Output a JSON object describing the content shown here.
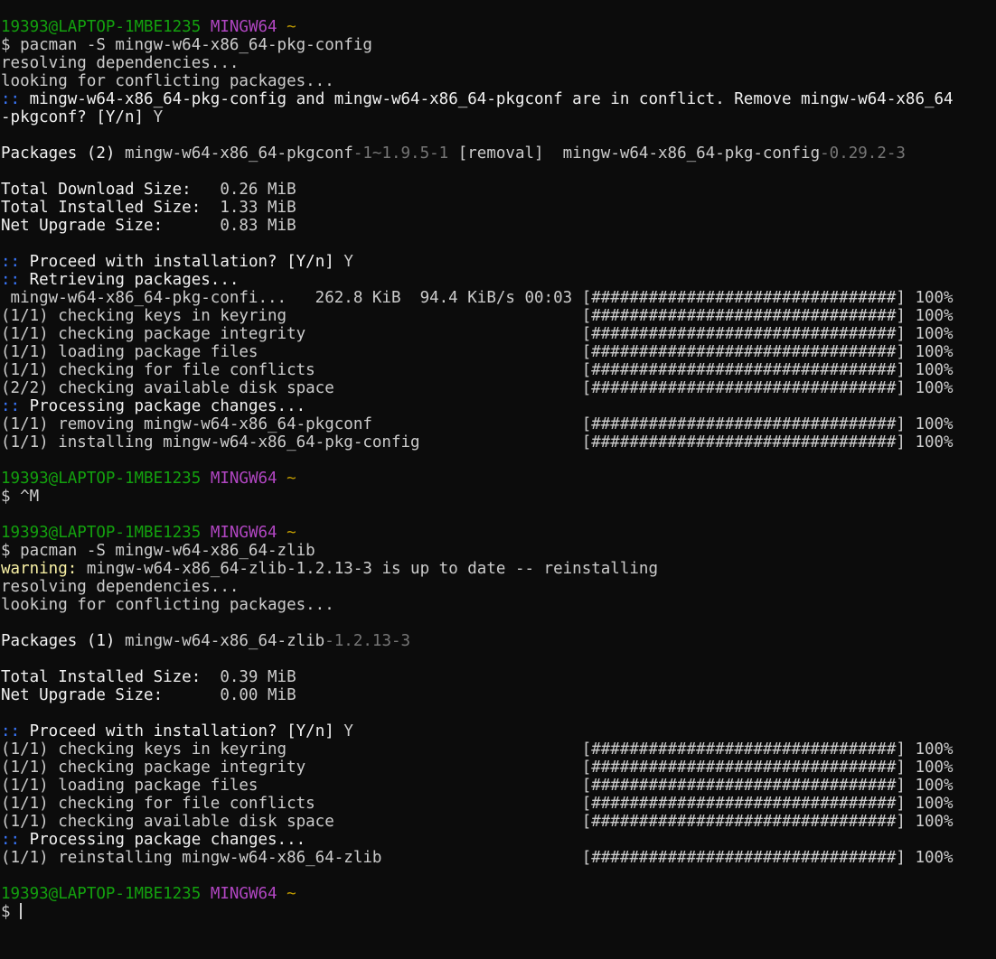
{
  "terminal": {
    "lines": [
      [
        {
          "text": "19393@LAPTOP-1MBE1235",
          "c": "green"
        },
        {
          "text": " ",
          "c": "default"
        },
        {
          "text": "MINGW64",
          "c": "magenta"
        },
        {
          "text": " ",
          "c": "default"
        },
        {
          "text": "~",
          "c": "yellow"
        }
      ],
      [
        {
          "text": "$ pacman -S mingw-w64-x86_64-pkg-config",
          "c": "default"
        }
      ],
      [
        {
          "text": "resolving dependencies...",
          "c": "default"
        }
      ],
      [
        {
          "text": "looking for conflicting packages...",
          "c": "default"
        }
      ],
      [
        {
          "text": "::",
          "c": "blue"
        },
        {
          "text": " mingw-w64-x86_64-pkg-config and mingw-w64-x86_64-pkgconf are in conflict. Remove mingw-w64-x86_64",
          "c": "white"
        }
      ],
      [
        {
          "text": "-pkgconf? [Y/n] ",
          "c": "white"
        },
        {
          "text": "Y",
          "c": "default"
        }
      ],
      [],
      [
        {
          "text": "Packages (2) ",
          "c": "white"
        },
        {
          "text": "mingw-w64-x86_64-pkgconf",
          "c": "default"
        },
        {
          "text": "-1~1.9.5-1",
          "c": "gray"
        },
        {
          "text": " [removal]  ",
          "c": "default"
        },
        {
          "text": "mingw-w64-x86_64-pkg-config",
          "c": "default"
        },
        {
          "text": "-0.29.2-3",
          "c": "gray"
        }
      ],
      [],
      [
        {
          "text": "Total Download Size:   ",
          "c": "white"
        },
        {
          "text": "0.26 MiB",
          "c": "default"
        }
      ],
      [
        {
          "text": "Total Installed Size:  ",
          "c": "white"
        },
        {
          "text": "1.33 MiB",
          "c": "default"
        }
      ],
      [
        {
          "text": "Net Upgrade Size:      ",
          "c": "white"
        },
        {
          "text": "0.83 MiB",
          "c": "default"
        }
      ],
      [],
      [
        {
          "text": "::",
          "c": "blue"
        },
        {
          "text": " Proceed with installation? [Y/n] ",
          "c": "white"
        },
        {
          "text": "Y",
          "c": "default"
        }
      ],
      [
        {
          "text": "::",
          "c": "blue"
        },
        {
          "text": " Retrieving packages...",
          "c": "white"
        }
      ],
      [
        {
          "text": " mingw-w64-x86_64-pkg-confi...   262.8 KiB  94.4 KiB/s 00:03 [################################] 100%",
          "c": "default"
        }
      ],
      [
        {
          "text": "(1/1) checking keys in keyring                               [################################] 100%",
          "c": "default"
        }
      ],
      [
        {
          "text": "(1/1) checking package integrity                             [################################] 100%",
          "c": "default"
        }
      ],
      [
        {
          "text": "(1/1) loading package files                                  [################################] 100%",
          "c": "default"
        }
      ],
      [
        {
          "text": "(1/1) checking for file conflicts                            [################################] 100%",
          "c": "default"
        }
      ],
      [
        {
          "text": "(2/2) checking available disk space                          [################################] 100%",
          "c": "default"
        }
      ],
      [
        {
          "text": "::",
          "c": "blue"
        },
        {
          "text": " Processing package changes...",
          "c": "white"
        }
      ],
      [
        {
          "text": "(1/1) removing mingw-w64-x86_64-pkgconf                      [################################] 100%",
          "c": "default"
        }
      ],
      [
        {
          "text": "(1/1) installing mingw-w64-x86_64-pkg-config                 [################################] 100%",
          "c": "default"
        }
      ],
      [],
      [
        {
          "text": "19393@LAPTOP-1MBE1235",
          "c": "green"
        },
        {
          "text": " ",
          "c": "default"
        },
        {
          "text": "MINGW64",
          "c": "magenta"
        },
        {
          "text": " ",
          "c": "default"
        },
        {
          "text": "~",
          "c": "yellow"
        }
      ],
      [
        {
          "text": "$ ^M",
          "c": "default"
        }
      ],
      [],
      [
        {
          "text": "19393@LAPTOP-1MBE1235",
          "c": "green"
        },
        {
          "text": " ",
          "c": "default"
        },
        {
          "text": "MINGW64",
          "c": "magenta"
        },
        {
          "text": " ",
          "c": "default"
        },
        {
          "text": "~",
          "c": "yellow"
        }
      ],
      [
        {
          "text": "$ pacman -S mingw-w64-x86_64-zlib",
          "c": "default"
        }
      ],
      [
        {
          "text": "warning:",
          "c": "yellow-bright"
        },
        {
          "text": " mingw-w64-x86_64-zlib-1.2.13-3 is up to date -- reinstalling",
          "c": "default"
        }
      ],
      [
        {
          "text": "resolving dependencies...",
          "c": "default"
        }
      ],
      [
        {
          "text": "looking for conflicting packages...",
          "c": "default"
        }
      ],
      [],
      [
        {
          "text": "Packages (1) ",
          "c": "white"
        },
        {
          "text": "mingw-w64-x86_64-zlib",
          "c": "default"
        },
        {
          "text": "-1.2.13-3",
          "c": "gray"
        }
      ],
      [],
      [
        {
          "text": "Total Installed Size:  ",
          "c": "white"
        },
        {
          "text": "0.39 MiB",
          "c": "default"
        }
      ],
      [
        {
          "text": "Net Upgrade Size:      ",
          "c": "white"
        },
        {
          "text": "0.00 MiB",
          "c": "default"
        }
      ],
      [],
      [
        {
          "text": "::",
          "c": "blue"
        },
        {
          "text": " Proceed with installation? [Y/n] ",
          "c": "white"
        },
        {
          "text": "Y",
          "c": "default"
        }
      ],
      [
        {
          "text": "(1/1) checking keys in keyring                               [################################] 100%",
          "c": "default"
        }
      ],
      [
        {
          "text": "(1/1) checking package integrity                             [################################] 100%",
          "c": "default"
        }
      ],
      [
        {
          "text": "(1/1) loading package files                                  [################################] 100%",
          "c": "default"
        }
      ],
      [
        {
          "text": "(1/1) checking for file conflicts                            [################################] 100%",
          "c": "default"
        }
      ],
      [
        {
          "text": "(1/1) checking available disk space                          [################################] 100%",
          "c": "default"
        }
      ],
      [
        {
          "text": "::",
          "c": "blue"
        },
        {
          "text": " Processing package changes...",
          "c": "white"
        }
      ],
      [
        {
          "text": "(1/1) reinstalling mingw-w64-x86_64-zlib                     [################################] 100%",
          "c": "default"
        }
      ],
      [],
      [
        {
          "text": "19393@LAPTOP-1MBE1235",
          "c": "green"
        },
        {
          "text": " ",
          "c": "default"
        },
        {
          "text": "MINGW64",
          "c": "magenta"
        },
        {
          "text": " ",
          "c": "default"
        },
        {
          "text": "~",
          "c": "yellow"
        }
      ],
      [
        {
          "text": "$ ",
          "c": "default"
        }
      ]
    ],
    "input_value": ""
  },
  "colors": {
    "background": "#0c0c0c",
    "default": "#cccccc",
    "green": "#13a10e",
    "magenta": "#b146c2",
    "yellow": "#c19c00",
    "yellow-bright": "#f9f1a5",
    "blue": "#3b78ff",
    "gray": "#767676",
    "white": "#f2f2f2"
  }
}
